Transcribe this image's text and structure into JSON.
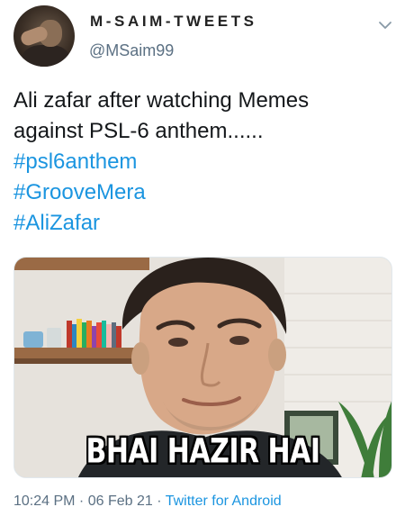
{
  "author": {
    "display_name": "M-SAIM-TWEETS",
    "handle": "@MSaim99",
    "avatar_icon": "user-avatar"
  },
  "menu_icon": "chevron-down-icon",
  "tweet": {
    "text_line1": "Ali zafar after watching Memes",
    "text_line2": "against PSL-6 anthem......",
    "hashtags": [
      "#psl6anthem",
      "#GrooveMera",
      "#AliZafar"
    ],
    "link_color": "#1b95e0"
  },
  "media": {
    "caption": "BHAI HAZIR HAI"
  },
  "meta": {
    "time": "10:24 PM",
    "separator": " · ",
    "date": "06 Feb 21",
    "source": "Twitter for Android"
  }
}
